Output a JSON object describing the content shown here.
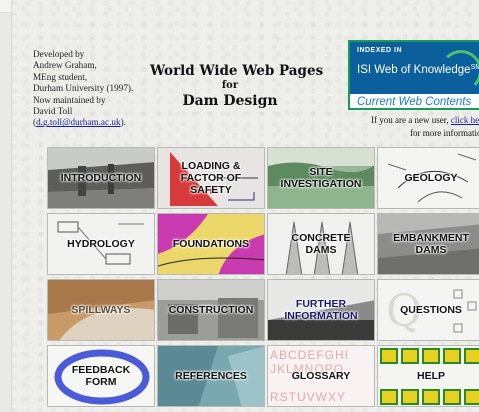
{
  "credits": {
    "lines": [
      "Developed by",
      "Andrew Graham,",
      "MEng student,",
      "Durham University (1997).",
      "Now maintained by",
      "David Toll"
    ],
    "email": "d.g.toll@durham.ac.uk",
    "email_open": "(",
    "email_close": ")."
  },
  "title": {
    "line1": "World Wide Web Pages",
    "line2": "for",
    "line3": "Dam Design"
  },
  "isi_badge": {
    "indexed": "INDEXED IN",
    "wok": "ISI Web of Knowledge",
    "tm": "SM",
    "cwc": "Current Web Contents"
  },
  "notice": {
    "prefix": "If you are a new user, ",
    "link": "click he",
    "line2": "for more informatio"
  },
  "tiles": [
    {
      "label": "INTRODUCTION"
    },
    {
      "label": "LOADING &\nFACTOR OF\nSAFETY"
    },
    {
      "label": "SITE\nINVESTIGATION"
    },
    {
      "label": "GEOLOGY"
    },
    {
      "label": "HYDROLOGY"
    },
    {
      "label": "FOUNDATIONS"
    },
    {
      "label": "CONCRETE\nDAMS"
    },
    {
      "label": "EMBANKMENT\nDAMS"
    },
    {
      "label": "SPILLWAYS"
    },
    {
      "label": "CONSTRUCTION"
    },
    {
      "label": "FURTHER\nINFORMATION"
    },
    {
      "label": "QUESTIONS"
    },
    {
      "label": "FEEDBACK\nFORM"
    },
    {
      "label": "REFERENCES"
    },
    {
      "label": "GLOSSARY"
    },
    {
      "label": "HELP"
    }
  ],
  "glossary_letters": [
    "ABCDEFGHI",
    "JKLMNOPQ",
    "RSTUVWXY"
  ],
  "colors": {
    "isi_band": "#0a5f9c",
    "isi_border": "#1a9a5a",
    "link": "#1a1aa8"
  }
}
